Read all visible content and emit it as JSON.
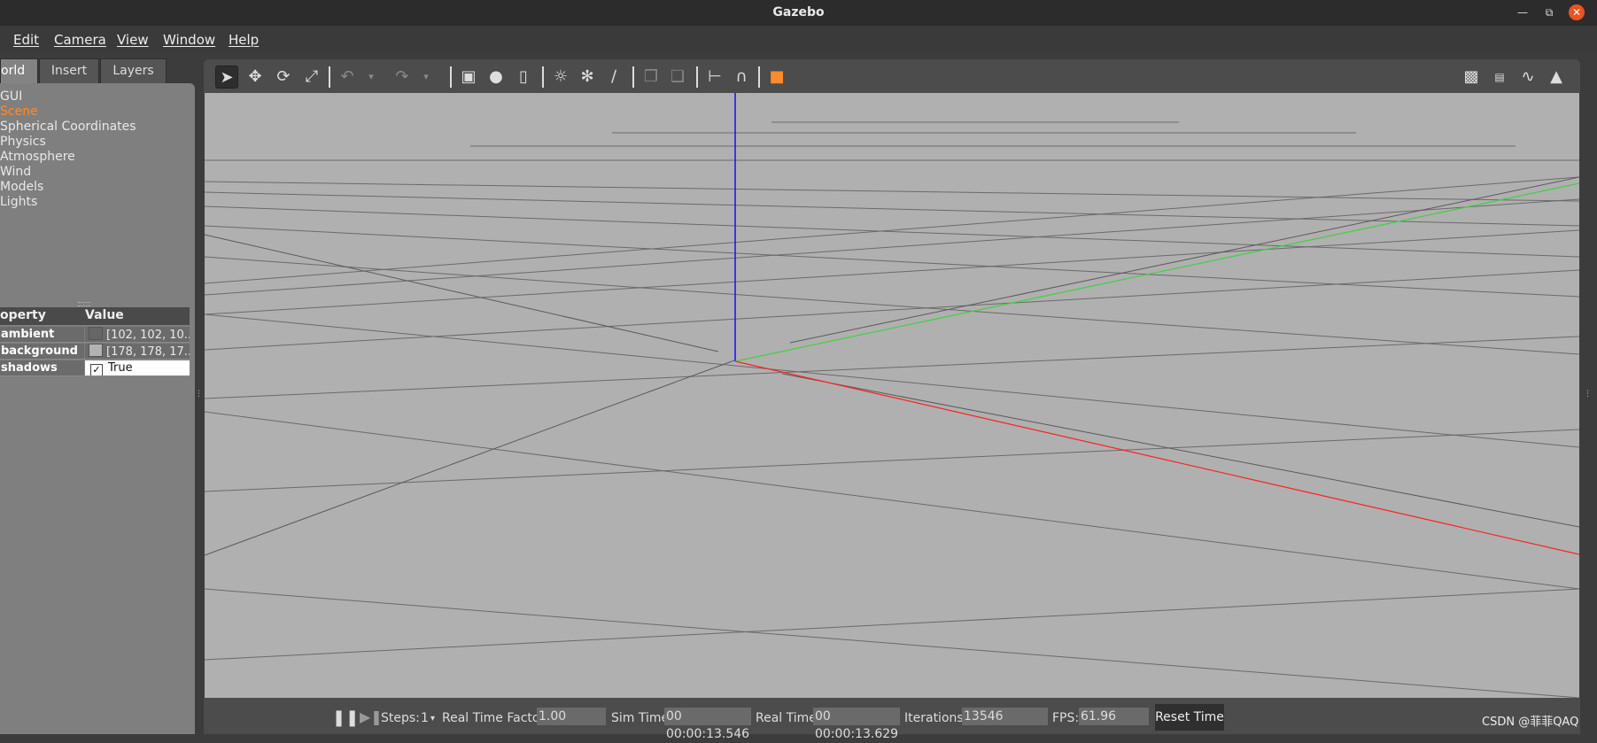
{
  "window": {
    "title": "Gazebo"
  },
  "menu": [
    "Edit",
    "Camera",
    "View",
    "Window",
    "Help"
  ],
  "tabs": [
    "orld",
    "Insert",
    "Layers"
  ],
  "tree": [
    "GUI",
    "Scene",
    "Spherical Coordinates",
    "Physics",
    "Atmosphere",
    "Wind",
    "Models",
    "Lights"
  ],
  "properties": {
    "header_property": "operty",
    "header_value": "Value",
    "rows": [
      {
        "name": "ambient",
        "value": "[102, 102, 10...",
        "swatch": "#666666"
      },
      {
        "name": "background",
        "value": "[178, 178, 17...",
        "swatch": "#b2b2b2"
      },
      {
        "name": "shadows",
        "value": "True",
        "checked": "✓"
      }
    ]
  },
  "toolbar": {
    "icons": [
      "select-mode",
      "translate-mode",
      "rotate-mode",
      "scale-mode",
      "undo",
      "undo-history",
      "redo",
      "redo-history",
      "box-shape",
      "sphere-shape",
      "cylinder-shape",
      "point-light",
      "spot-light",
      "directional-light",
      "copy",
      "paste",
      "align",
      "snap",
      "view-angle",
      "screenshot",
      "log",
      "plot",
      "record-video"
    ]
  },
  "bottom": {
    "steps_label": "Steps:",
    "steps_value": "1",
    "rtf_label": "Real Time Factor:",
    "rtf_value": "1.00",
    "sim_label": "Sim Time:",
    "sim_value": "00 00:00:13.546",
    "real_label": "Real Time:",
    "real_value": "00 00:00:13.629",
    "iter_label": "Iterations:",
    "iter_value": "13546",
    "fps_label": "FPS:",
    "fps_value": "61.96",
    "reset_label": "Reset Time"
  },
  "watermark": "CSDN @菲菲QAQ",
  "colors": {
    "viewport": "#b0b0b0",
    "x_axis": "#ff2020",
    "y_axis": "#40d040",
    "z_axis": "#1010ff",
    "selected": "#ff8a2b"
  }
}
